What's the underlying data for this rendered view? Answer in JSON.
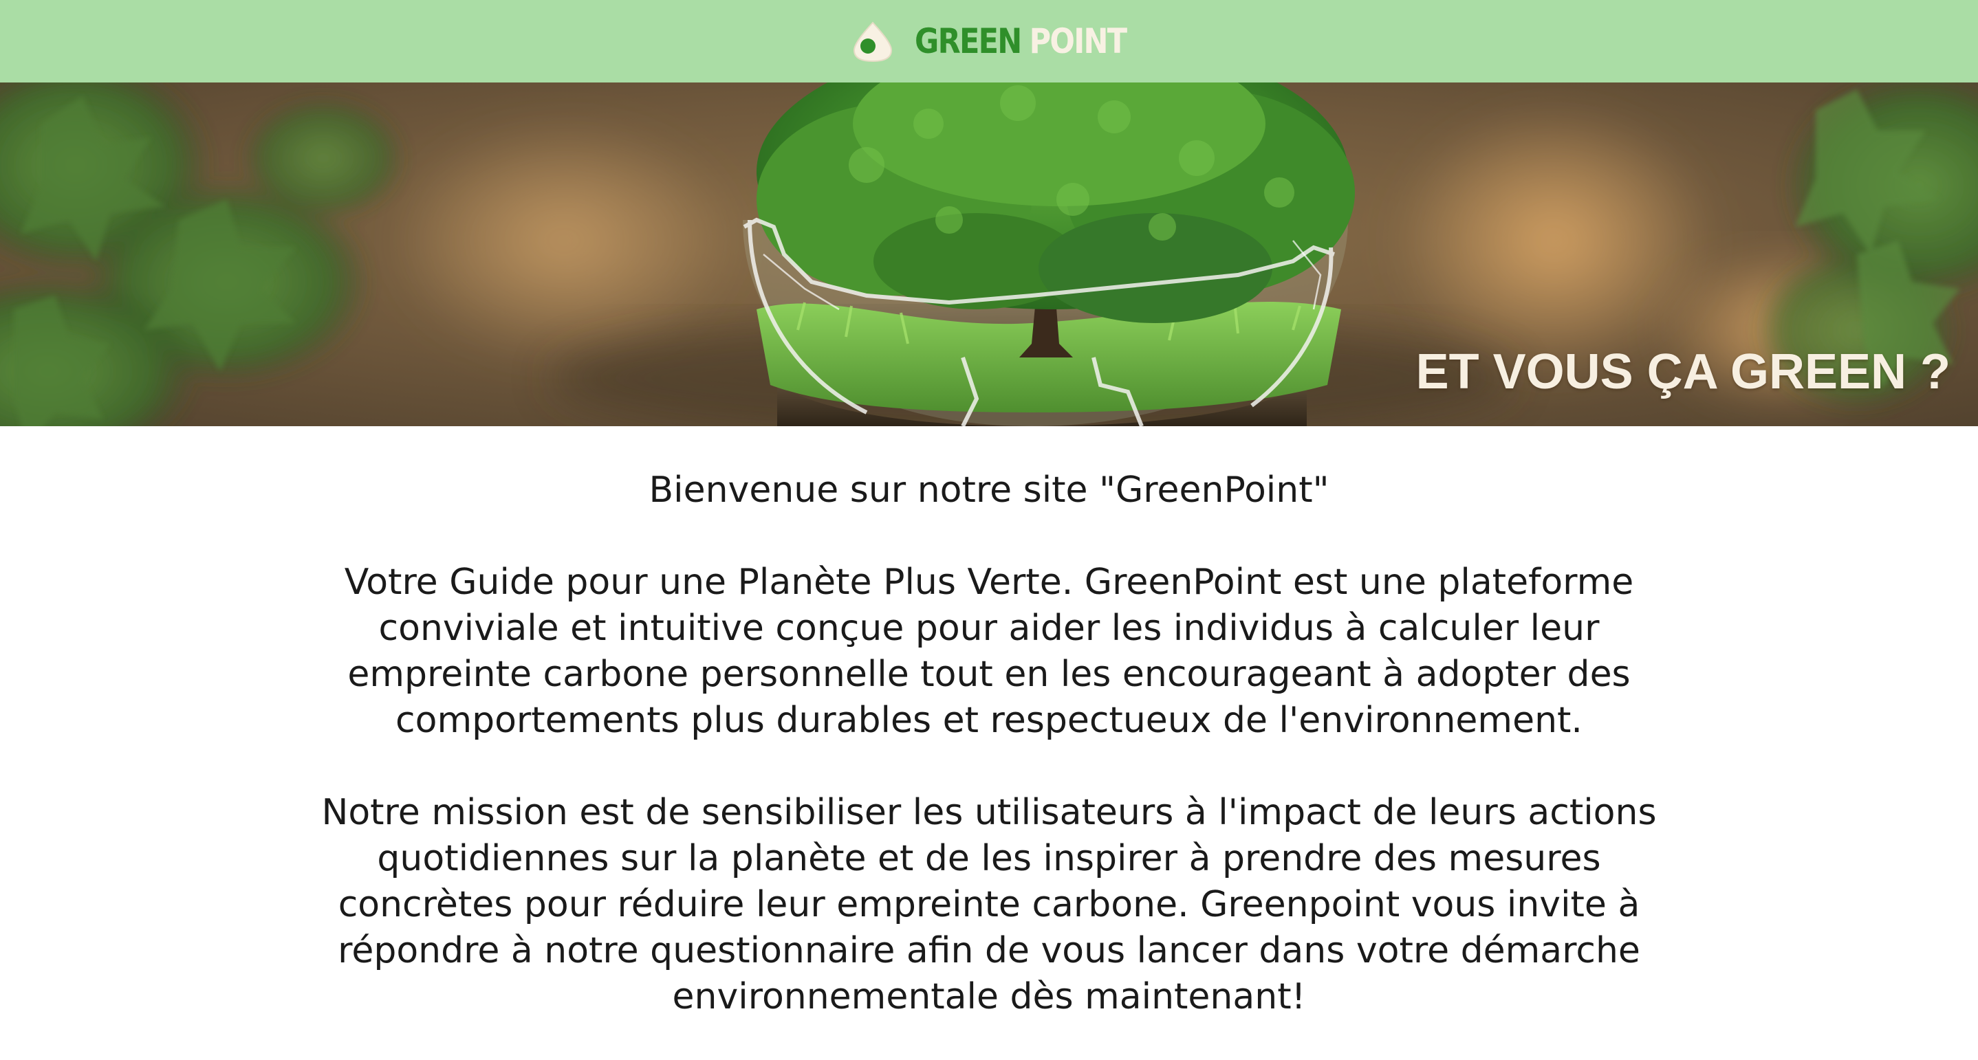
{
  "header": {
    "logo_word_1": "GREEN",
    "logo_word_2": "POINT",
    "logo_icon": "leaf-drop-icon",
    "background_color": "#aadda5",
    "accent_dark_green": "#2f8f2a",
    "accent_cream": "#f8f1e3"
  },
  "hero": {
    "slogan": "ET VOUS ÇA GREEN ?",
    "image": "tree-in-glass-globe"
  },
  "intro": {
    "welcome": "Bienvenue sur notre site \"GreenPoint\"",
    "paragraph_1": "Votre Guide pour une Planète Plus Verte. GreenPoint est une plateforme conviviale et intuitive conçue pour aider les individus à calculer leur empreinte carbone personnelle tout en les encourageant à adopter des comportements plus durables et respectueux de l'environnement.",
    "paragraph_2": "Notre mission est de sensibiliser les utilisateurs à l'impact de leurs actions quotidiennes sur la planète et de les inspirer à prendre des mesures concrètes pour réduire leur empreinte carbone. Greenpoint vous invite à répondre à notre questionnaire afin de vous lancer dans votre démarche environnementale dès maintenant!"
  }
}
